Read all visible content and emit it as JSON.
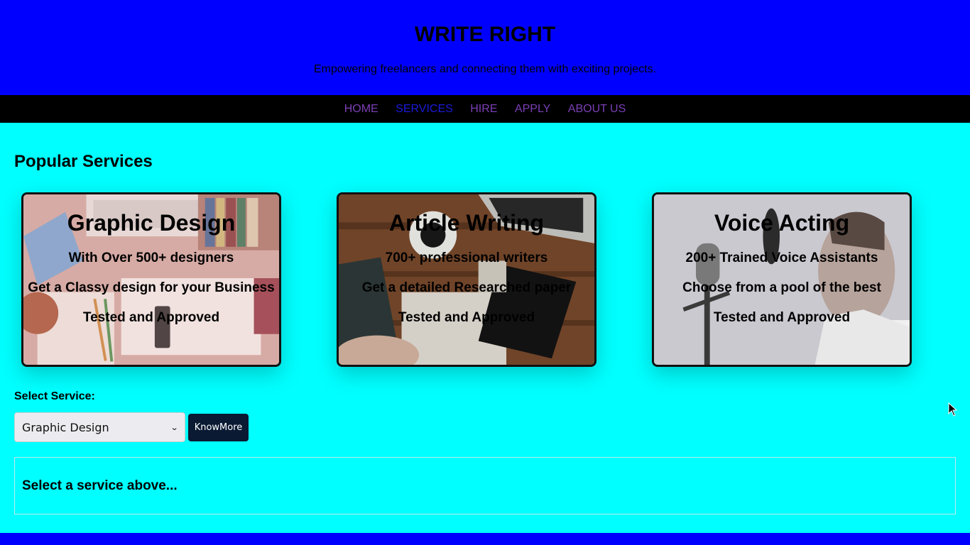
{
  "header": {
    "title": "WRITE RIGHT",
    "tagline": "Empowering freelancers and connecting them with exciting projects."
  },
  "nav": {
    "items": [
      {
        "label": "HOME",
        "color": "#7a3fb5"
      },
      {
        "label": "SERVICES",
        "color": "#1a1adc"
      },
      {
        "label": "HIRE",
        "color": "#7a3fb5"
      },
      {
        "label": "APPLY",
        "color": "#7a3fb5"
      },
      {
        "label": "ABOUT US",
        "color": "#7a3fb5"
      }
    ]
  },
  "main": {
    "section_title": "Popular Services",
    "cards": [
      {
        "title": "Graphic Design",
        "lines": [
          "With Over 500+ designers",
          "Get a Classy design for your Business",
          "Tested and Approved"
        ],
        "image": "desk-workspace-photo"
      },
      {
        "title": "Article Writing",
        "lines": [
          "700+ professional writers",
          "Get a detailed Researched paper",
          "Tested and Approved"
        ],
        "image": "writing-desk-photo"
      },
      {
        "title": "Voice Acting",
        "lines": [
          "200+ Trained Voice Assistants",
          "Choose from a pool of the best",
          "Tested and Approved"
        ],
        "image": "microphone-singer-photo"
      }
    ],
    "select_label": "Select Service:",
    "select_value": "Graphic Design",
    "button_label": "KnowMore",
    "result_text": "Select a service above..."
  },
  "colors": {
    "header_bg": "#0000ff",
    "page_bg": "#00ffff",
    "nav_bg": "#000000",
    "button_bg": "#0a1a33"
  }
}
